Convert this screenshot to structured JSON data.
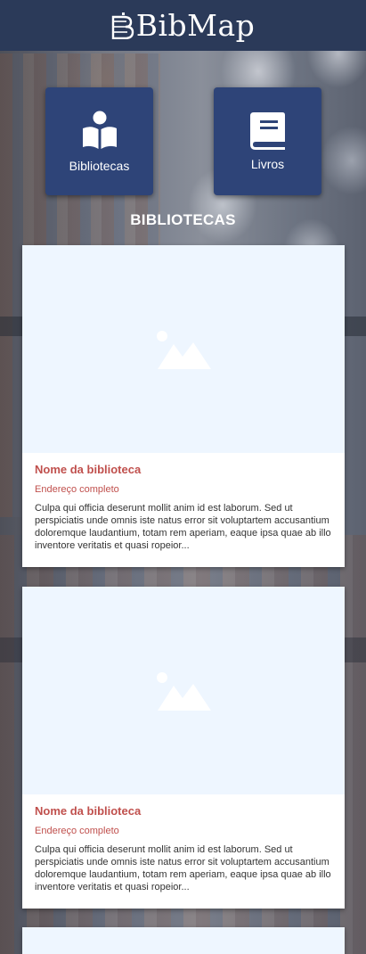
{
  "app": {
    "title": "BibMap"
  },
  "nav": [
    {
      "label": "Bibliotecas",
      "icon": "book-reader-icon"
    },
    {
      "label": "Livros",
      "icon": "book-icon"
    }
  ],
  "section": {
    "title": "BIBLIOTECAS"
  },
  "libraries": [
    {
      "name": "Nome da biblioteca",
      "address": "Endereço completo",
      "description": "Culpa qui officia deserunt mollit anim id est laborum. Sed ut perspiciatis unde omnis iste natus error sit voluptartem accusantium doloremque laudantium, totam rem aperiam, eaque ipsa quae ab illo inventore veritatis et quasi ropeior..."
    },
    {
      "name": "Nome da biblioteca",
      "address": "Endereço completo",
      "description": "Culpa qui officia deserunt mollit anim id est laborum. Sed ut perspiciatis unde omnis iste natus error sit voluptartem accusantium doloremque laudantium, totam rem aperiam, eaque ipsa quae ab illo inventore veritatis et quasi ropeior..."
    }
  ],
  "colors": {
    "header": "#2b3a59",
    "tile": "#2e4478",
    "accent": "#c0504d",
    "image_placeholder": "#eef6ff"
  }
}
